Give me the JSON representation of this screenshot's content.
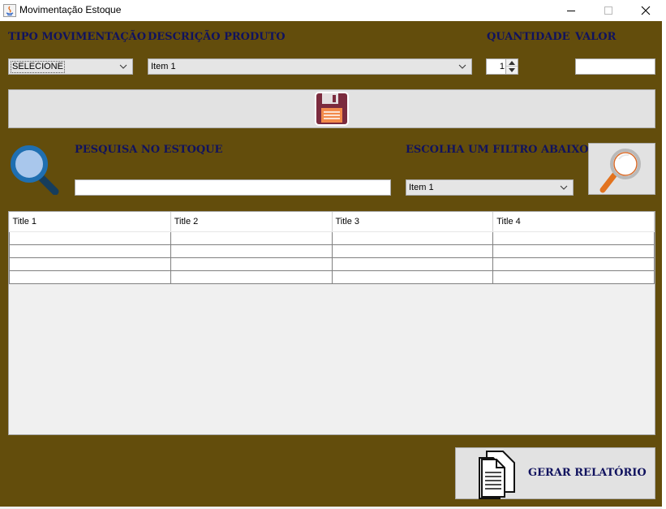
{
  "window": {
    "title": "Movimentação Estoque",
    "controls": {
      "minimize": "—",
      "maximize": "☐",
      "close": "✕"
    }
  },
  "form": {
    "tipo_label": "TIPO MOVIMENTAÇÃO",
    "tipo_value": "SELECIONE",
    "descricao_label": "DESCRIÇÃO PRODUTO",
    "descricao_value": "Item 1",
    "quantidade_label": "QUANTIDADE",
    "quantidade_value": "1",
    "valor_label": "VALOR",
    "valor_value": ""
  },
  "save_button": {
    "icon": "floppy-disk-icon"
  },
  "search": {
    "label": "PESQUISA NO ESTOQUE",
    "value": "",
    "filter_label": "ESCOLHA UM FILTRO ABAIXO",
    "filter_value": "Item 1",
    "icon": "magnifier-icon"
  },
  "table": {
    "columns": [
      "Title 1",
      "Title 2",
      "Title 3",
      "Title 4"
    ],
    "rows": [
      [
        "",
        "",
        "",
        ""
      ],
      [
        "",
        "",
        "",
        ""
      ],
      [
        "",
        "",
        "",
        ""
      ],
      [
        "",
        "",
        "",
        ""
      ]
    ]
  },
  "report_button": {
    "label": "GERAR RELATÓRIO",
    "icon": "document-icon"
  },
  "colors": {
    "background": "#634d0c",
    "label": "#10125e",
    "button": "#e2e2e2"
  }
}
